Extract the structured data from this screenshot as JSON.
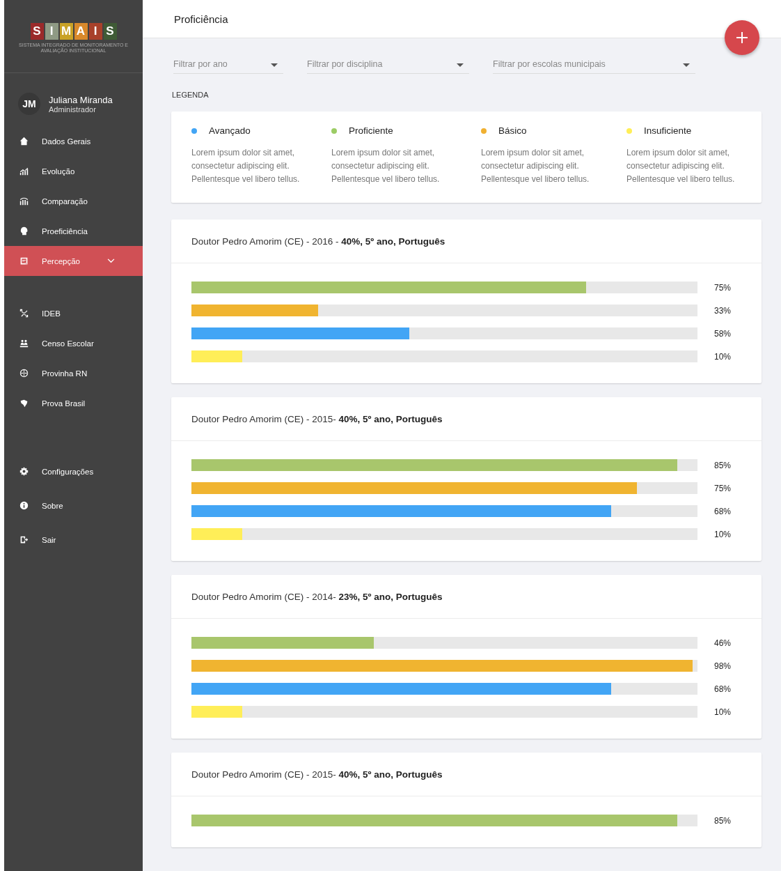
{
  "sidebar": {
    "logo": {
      "letters": [
        {
          "char": "S",
          "color": "#9b2a2a"
        },
        {
          "char": "I",
          "color": "#8f9a84"
        },
        {
          "char": "M",
          "color": "#c9a227"
        },
        {
          "char": "A",
          "color": "#d9892b"
        },
        {
          "char": "I",
          "color": "#a8412a"
        },
        {
          "char": "S",
          "color": "#3f5b36"
        }
      ],
      "subtitle": "SISTEMA INTEGRADO DE MONITORAMENTO E AVALIAÇÃO INSTITUCIONAL"
    },
    "user": {
      "initials": "JM",
      "name": "Juliana Miranda",
      "role": "Administrador"
    },
    "groups": [
      {
        "items": [
          {
            "label": "Dados Gerais",
            "selected": false,
            "expandable": false
          },
          {
            "label": "Evolução",
            "selected": false,
            "expandable": false
          },
          {
            "label": "Comparação",
            "selected": false,
            "expandable": false
          },
          {
            "label": "Proeficiência",
            "selected": false,
            "expandable": false
          },
          {
            "label": "Percepção",
            "selected": true,
            "expandable": true
          }
        ]
      },
      {
        "items": [
          {
            "label": "IDEB",
            "selected": false,
            "expandable": false
          },
          {
            "label": "Censo Escolar",
            "selected": false,
            "expandable": false
          },
          {
            "label": "Provinha RN",
            "selected": false,
            "expandable": false
          },
          {
            "label": "Prova Brasil",
            "selected": false,
            "expandable": false
          }
        ]
      },
      {
        "items": [
          {
            "label": "Configurações",
            "selected": false,
            "expandable": false
          },
          {
            "label": "Sobre",
            "selected": false,
            "expandable": false
          },
          {
            "label": "Sair",
            "selected": false,
            "expandable": false
          }
        ]
      }
    ]
  },
  "header": {
    "title": "Proficiência"
  },
  "filters": [
    {
      "placeholder": "Filtrar por ano"
    },
    {
      "placeholder": "Filtrar por disciplina"
    },
    {
      "placeholder": "Filtrar por escolas municipais"
    }
  ],
  "legend": {
    "title": "LEGENDA",
    "items": [
      {
        "label": "Avançado",
        "color": "#42a5f5",
        "description": "Lorem ipsum dolor sit amet,  consectetur adipiscing elit. Pellentesque vel libero tellus."
      },
      {
        "label": "Proficiente",
        "color": "#9ccc65",
        "description": "Lorem ipsum dolor sit amet,  consectetur adipiscing elit. Pellentesque vel libero tellus."
      },
      {
        "label": "Básico",
        "color": "#f0b030",
        "description": "Lorem ipsum dolor sit amet, consectetur adipiscing elit. Pellentesque vel libero tellus."
      },
      {
        "label": "Insuficiente",
        "color": "#ffee58",
        "description": "Lorem ipsum dolor sit amet, consectetur adipiscing elit. Pellentesque vel libero tellus."
      }
    ]
  },
  "cards": [
    {
      "title": "Doutor Pedro Amorim (CE) - 2016 - **40%, 5º ano, Português**",
      "bars": [
        {
          "color": "#a8c66c",
          "level": 0.78,
          "reading": "75%"
        },
        {
          "color": "#f0b430",
          "level": 0.25,
          "reading": "33%"
        },
        {
          "color": "#42a5f5",
          "level": 0.43,
          "reading": "58%"
        },
        {
          "color": "#ffee58",
          "level": 0.1,
          "reading": "10%"
        }
      ]
    },
    {
      "title": "Doutor Pedro Amorim (CE) - 2015- **40%, 5º ano, Português**",
      "bars": [
        {
          "color": "#a8c66c",
          "level": 0.96,
          "reading": "85%"
        },
        {
          "color": "#f0b430",
          "level": 0.88,
          "reading": "75%"
        },
        {
          "color": "#42a5f5",
          "level": 0.83,
          "reading": "68%"
        },
        {
          "color": "#ffee58",
          "level": 0.1,
          "reading": "10%"
        }
      ]
    },
    {
      "title": "Doutor Pedro Amorim (CE) - 2014- **23%, 5º ano, Português**",
      "bars": [
        {
          "color": "#a8c66c",
          "level": 0.36,
          "reading": "46%"
        },
        {
          "color": "#f0b430",
          "level": 0.99,
          "reading": "98%"
        },
        {
          "color": "#42a5f5",
          "level": 0.83,
          "reading": "68%"
        },
        {
          "color": "#ffee58",
          "level": 0.1,
          "reading": "10%"
        }
      ]
    },
    {
      "title": "Doutor Pedro Amorim (CE) - 2015- **40%, 5º ano, Português**",
      "bars": [
        {
          "color": "#a8c66c",
          "level": 0.96,
          "reading": "85%"
        }
      ]
    }
  ]
}
